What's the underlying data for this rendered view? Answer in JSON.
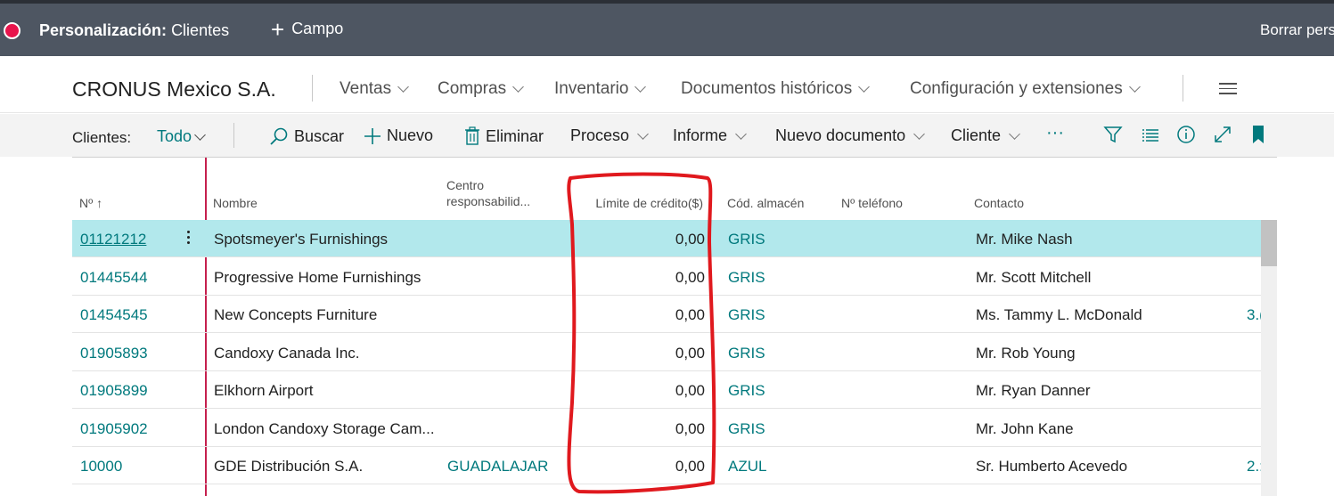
{
  "designer": {
    "title_bold": "Personalización:",
    "title_rest": "Clientes",
    "add_field": "Campo",
    "clear_label": "Borrar pers"
  },
  "nav": {
    "company": "CRONUS Mexico S.A.",
    "items": [
      "Ventas",
      "Compras",
      "Inventario",
      "Documentos históricos",
      "Configuración y extensiones"
    ]
  },
  "actions": {
    "list_label": "Clientes:",
    "view": "Todo",
    "search": "Buscar",
    "new": "Nuevo",
    "delete": "Eliminar",
    "process": "Proceso",
    "report": "Informe",
    "new_document": "Nuevo documento",
    "customer": "Cliente",
    "more": "···"
  },
  "table": {
    "headers": {
      "no": "Nº",
      "no_sort": "↑",
      "name": "Nombre",
      "center_1": "Centro",
      "center_2": "responsabilid...",
      "credit": "Límite de crédito($)",
      "location": "Cód. almacén",
      "phone": "Nº teléfono",
      "contact": "Contacto"
    },
    "rows": [
      {
        "no": "01121212",
        "name": "Spotsmeyer's Furnishings",
        "center": "",
        "credit": "0,00",
        "location": "GRIS",
        "phone": "",
        "contact": "Mr. Mike Nash",
        "extra": ""
      },
      {
        "no": "01445544",
        "name": "Progressive Home Furnishings",
        "center": "",
        "credit": "0,00",
        "location": "GRIS",
        "phone": "",
        "contact": "Mr. Scott Mitchell",
        "extra": ""
      },
      {
        "no": "01454545",
        "name": "New Concepts Furniture",
        "center": "",
        "credit": "0,00",
        "location": "GRIS",
        "phone": "",
        "contact": "Ms. Tammy L. McDonald",
        "extra": "3.("
      },
      {
        "no": "01905893",
        "name": "Candoxy Canada Inc.",
        "center": "",
        "credit": "0,00",
        "location": "GRIS",
        "phone": "",
        "contact": "Mr. Rob Young",
        "extra": ""
      },
      {
        "no": "01905899",
        "name": "Elkhorn Airport",
        "center": "",
        "credit": "0,00",
        "location": "GRIS",
        "phone": "",
        "contact": "Mr. Ryan Danner",
        "extra": ""
      },
      {
        "no": "01905902",
        "name": "London Candoxy Storage Cam...",
        "center": "",
        "credit": "0,00",
        "location": "GRIS",
        "phone": "",
        "contact": "Mr. John Kane",
        "extra": ""
      },
      {
        "no": "10000",
        "name": "GDE Distribución S.A.",
        "center": "GUADALAJAR",
        "credit": "0,00",
        "location": "AZUL",
        "phone": "",
        "contact": "Sr. Humberto Acevedo",
        "extra": "2.:"
      }
    ]
  },
  "colors": {
    "accent": "#00797d",
    "selected_row": "#b2e8ec",
    "annotation": "#e0191e",
    "record_dot": "#e8144c"
  }
}
